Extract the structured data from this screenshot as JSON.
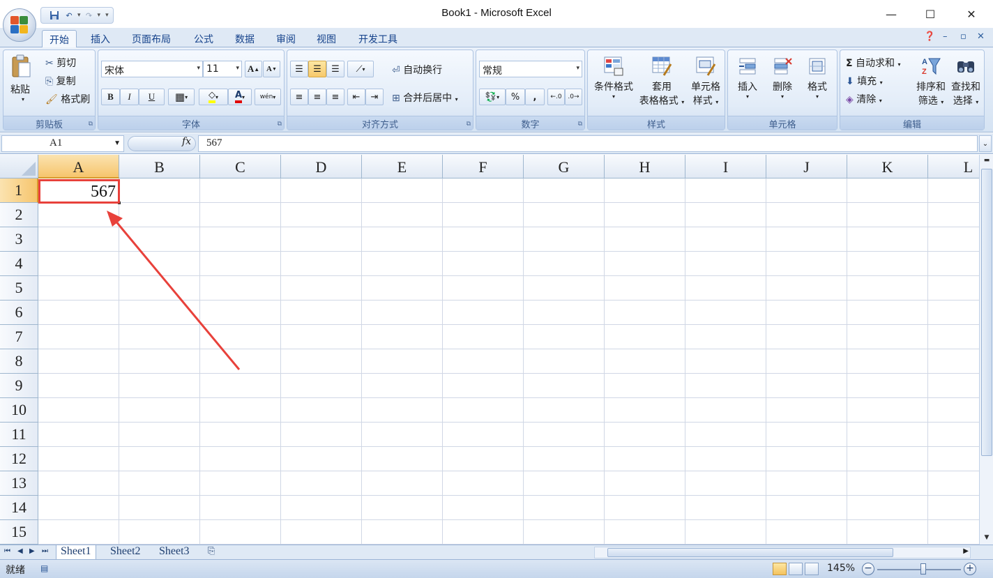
{
  "window": {
    "title": "Book1 - Microsoft Excel",
    "minimize": "—",
    "maximize": "☐",
    "close": "✕"
  },
  "tabs": [
    "开始",
    "插入",
    "页面布局",
    "公式",
    "数据",
    "审阅",
    "视图",
    "开发工具"
  ],
  "ribbon": {
    "clipboard": {
      "paste": "粘贴",
      "cut": "剪切",
      "copy": "复制",
      "format_painter": "格式刷",
      "label": "剪贴板"
    },
    "font": {
      "name": "宋体",
      "size": "11",
      "grow": "A",
      "shrink": "A",
      "bold": "B",
      "italic": "I",
      "underline": "U",
      "font_color": "A",
      "phonetic": "wén",
      "label": "字体"
    },
    "alignment": {
      "wrap": "自动换行",
      "merge": "合并后居中",
      "label": "对齐方式"
    },
    "number": {
      "format": "常规",
      "percent": "%",
      "comma": ",",
      "label": "数字"
    },
    "styles": {
      "conditional": "条件格式",
      "table_1": "套用",
      "table_2": "表格格式",
      "cell_1": "单元格",
      "cell_2": "样式",
      "label": "样式"
    },
    "cells": {
      "insert": "插入",
      "delete": "删除",
      "format": "格式",
      "label": "单元格"
    },
    "editing": {
      "autosum": "自动求和",
      "fill": "填充",
      "clear": "清除",
      "sort_1": "排序和",
      "sort_2": "筛选",
      "find_1": "查找和",
      "find_2": "选择",
      "label": "编辑"
    }
  },
  "formula_bar": {
    "name_box": "A1",
    "fx": "fx",
    "content": "567"
  },
  "columns": [
    "A",
    "B",
    "C",
    "D",
    "E",
    "F",
    "G",
    "H",
    "I",
    "J",
    "K",
    "L"
  ],
  "rows": [
    "1",
    "2",
    "3",
    "4",
    "5",
    "6",
    "7",
    "8",
    "9",
    "10",
    "11",
    "12",
    "13",
    "14",
    "15"
  ],
  "cells": {
    "A1": "567"
  },
  "sheets": [
    "Sheet1",
    "Sheet2",
    "Sheet3"
  ],
  "status": {
    "ready": "就绪",
    "zoom": "145%",
    "zoom_out": "−",
    "zoom_in": "+"
  },
  "colors": {
    "accent": "#15428b",
    "annotation": "#e8413b",
    "selected_header": "#f6c56d"
  }
}
